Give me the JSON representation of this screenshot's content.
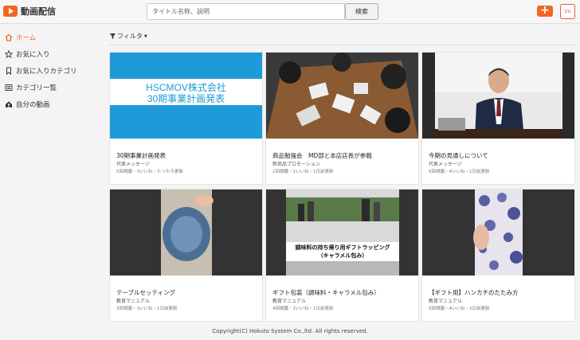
{
  "header": {
    "app_title": "動画配信",
    "search_placeholder": "タイトル名称、説明",
    "search_button": "検索",
    "upload_icon": "plus-icon",
    "avatar_text": "1%"
  },
  "sidebar": {
    "items": [
      {
        "label": "ホーム",
        "icon": "home-icon",
        "active": true
      },
      {
        "label": "お気に入り",
        "icon": "star-icon"
      },
      {
        "label": "お気に入りカテゴリ",
        "icon": "bookmark-icon"
      },
      {
        "label": "カテゴリ一覧",
        "icon": "list-icon"
      },
      {
        "label": "自分の動画",
        "icon": "user-home-icon"
      }
    ]
  },
  "filter": {
    "label": "フィルタ"
  },
  "videos": [
    {
      "title": "30期事業計画発表",
      "category": "代表メッセージ",
      "stats": "5回視聴・3いいね・たった今更新",
      "thumb_text": [
        "HSCMOV株式会社",
        "30期事業計画発表"
      ]
    },
    {
      "title": "商品勉強会　MD部と本店店長が参戦",
      "category": "新商品プロモーション",
      "stats": "1回視聴・1いいね・1日前更新"
    },
    {
      "title": "今期の見通しについて",
      "category": "代表メッセージ",
      "stats": "5回視聴・4いいね・1日前更新"
    },
    {
      "title": "テーブルセッティング",
      "category": "教育マニュアル",
      "stats": "3回視聴・3いいね・1日前更新"
    },
    {
      "title": "ギフト包装（調味料・キャラメル包み）",
      "category": "教育マニュアル",
      "stats": "4回視聴・2いいね・1日前更新",
      "thumb_text": [
        "調味料の持ち帰り用ギフトラッピング",
        "（キャラメル包み）"
      ]
    },
    {
      "title": "【ギフト用】ハンカチのたたみ方",
      "category": "教育マニュアル",
      "stats": "5回視聴・4いいね・2日前更新"
    }
  ],
  "footer": {
    "copyright": "Copyright(C) Hokuto System Co.,ltd. All rights reserved."
  },
  "colors": {
    "accent": "#f26522",
    "thumb_blue": "#1f9ad8"
  }
}
